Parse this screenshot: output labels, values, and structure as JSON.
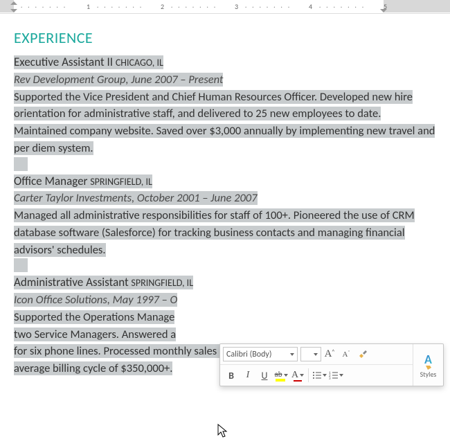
{
  "ruler": {
    "ticks": [
      "1",
      "2",
      "3",
      "4",
      "5"
    ]
  },
  "heading": "EXPERIENCE",
  "jobs": [
    {
      "title": "Executive Assistant II",
      "location": "CHICAGO, IL",
      "employer": "Rev Development Group, June 2007 – Present",
      "body": "Supported the Vice President and Chief Human Resources Officer. Developed new hire orientation for administrative staff, and delivered to 25 new employees to date. Maintained company website. Saved over $3,000 annually by implementing new travel and per diem system."
    },
    {
      "title": "Office Manager",
      "location": "SPRINGFIELD, IL",
      "employer": "Carter Taylor Investments, October 2001 – June 2007",
      "body": "Managed all administrative responsibilities for staff of 100+. Pioneered the use of CRM database software (Salesforce) for tracking business contacts and managing financial advisors' schedules."
    },
    {
      "title": "Administrative Assistant",
      "location": "SPRINGFIELD, IL",
      "employer_a": "Icon Office Solutions, May 1997 – ",
      "employer_b": "O",
      "body_a": "Supported the Operations Manage",
      "body_b": "two Service Managers. Answered a",
      "body_c": "for six phone lines. Processed mont",
      "body_c_tail": "hly sales bills for an",
      "body_d": "average billing cycle of $350,000+."
    }
  ],
  "toolbar": {
    "font_name": "Calibri (Body)",
    "font_size": "",
    "grow": "A",
    "shrink": "A",
    "bold": "B",
    "italic": "I",
    "underline": "U",
    "strike": "ab",
    "fontcolor": "A",
    "styles_label": "Styles",
    "styles_glyph": "A"
  }
}
